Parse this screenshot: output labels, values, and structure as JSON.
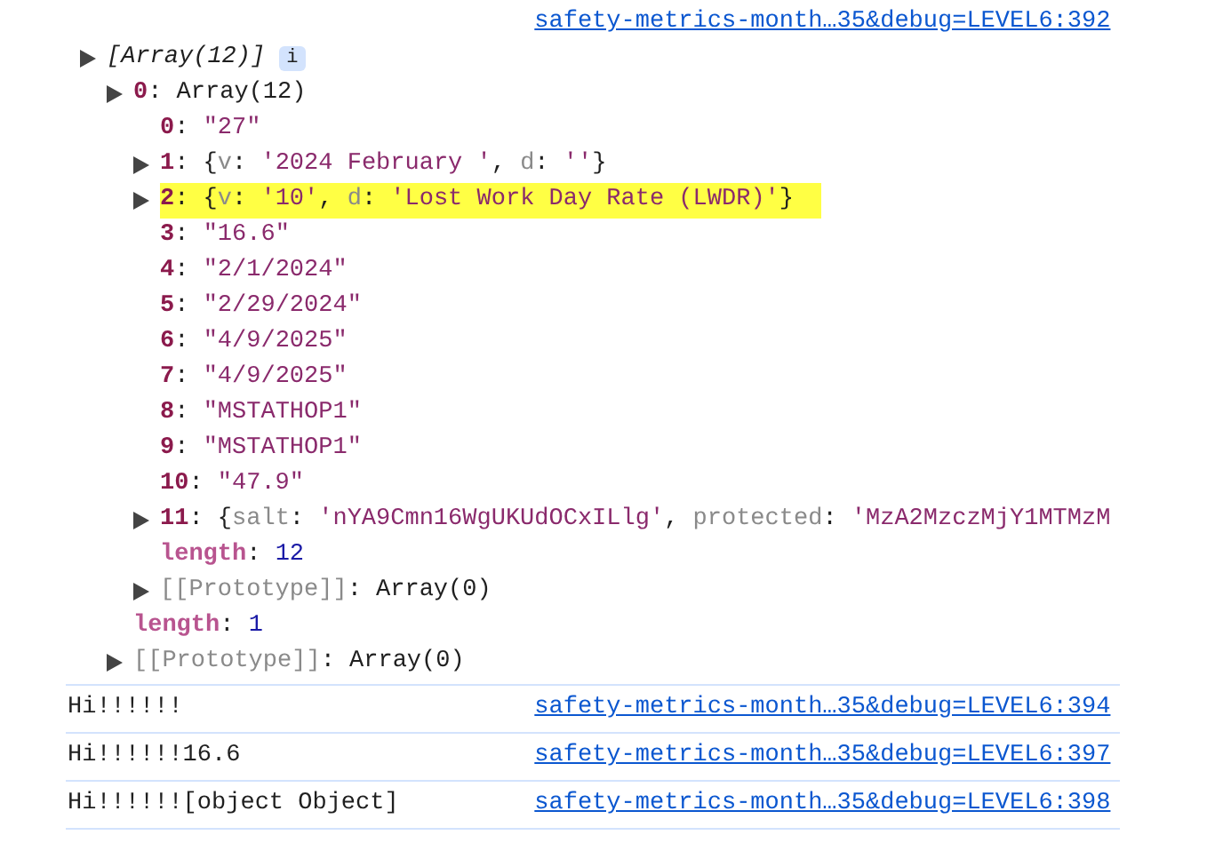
{
  "console": {
    "entries": [
      {
        "kind": "object",
        "link": "safety-metrics-month…35&debug=LEVEL6:392",
        "tree": [
          {
            "kind": "expandable",
            "badge": "i",
            "highlighted": false,
            "segments": [
              {
                "kind": "italic",
                "text": "[Array(12)]"
              }
            ],
            "children": [
              {
                "kind": "expandable",
                "highlighted": false,
                "segments": [
                  {
                    "kind": "index",
                    "text": "0"
                  },
                  {
                    "kind": "punct",
                    "text": ": Array(12)"
                  }
                ],
                "children": [
                  {
                    "kind": "leaf",
                    "highlighted": false,
                    "segments": [
                      {
                        "kind": "index",
                        "text": "0"
                      },
                      {
                        "kind": "punct",
                        "text": ": "
                      },
                      {
                        "kind": "string",
                        "text": "\"27\""
                      }
                    ]
                  },
                  {
                    "kind": "expandable",
                    "highlighted": false,
                    "segments": [
                      {
                        "kind": "index",
                        "text": "1"
                      },
                      {
                        "kind": "punct",
                        "text": ": {"
                      },
                      {
                        "kind": "preview_key",
                        "text": "v"
                      },
                      {
                        "kind": "punct",
                        "text": ": "
                      },
                      {
                        "kind": "string",
                        "text": "'2024 February '"
                      },
                      {
                        "kind": "punct",
                        "text": ", "
                      },
                      {
                        "kind": "preview_key",
                        "text": "d"
                      },
                      {
                        "kind": "punct",
                        "text": ": "
                      },
                      {
                        "kind": "string",
                        "text": "''"
                      },
                      {
                        "kind": "punct",
                        "text": "}"
                      }
                    ]
                  },
                  {
                    "kind": "expandable",
                    "highlighted": true,
                    "segments": [
                      {
                        "kind": "index",
                        "text": "2"
                      },
                      {
                        "kind": "punct",
                        "text": ": {"
                      },
                      {
                        "kind": "preview_key",
                        "text": "v"
                      },
                      {
                        "kind": "punct",
                        "text": ": "
                      },
                      {
                        "kind": "string",
                        "text": "'10'"
                      },
                      {
                        "kind": "punct",
                        "text": ", "
                      },
                      {
                        "kind": "preview_key",
                        "text": "d"
                      },
                      {
                        "kind": "punct",
                        "text": ": "
                      },
                      {
                        "kind": "string",
                        "text": "'Lost Work Day Rate (LWDR)'"
                      },
                      {
                        "kind": "punct",
                        "text": "}"
                      }
                    ]
                  },
                  {
                    "kind": "leaf",
                    "highlighted": false,
                    "segments": [
                      {
                        "kind": "index",
                        "text": "3"
                      },
                      {
                        "kind": "punct",
                        "text": ": "
                      },
                      {
                        "kind": "string",
                        "text": "\"16.6\""
                      }
                    ]
                  },
                  {
                    "kind": "leaf",
                    "highlighted": false,
                    "segments": [
                      {
                        "kind": "index",
                        "text": "4"
                      },
                      {
                        "kind": "punct",
                        "text": ": "
                      },
                      {
                        "kind": "string",
                        "text": "\"2/1/2024\""
                      }
                    ]
                  },
                  {
                    "kind": "leaf",
                    "highlighted": false,
                    "segments": [
                      {
                        "kind": "index",
                        "text": "5"
                      },
                      {
                        "kind": "punct",
                        "text": ": "
                      },
                      {
                        "kind": "string",
                        "text": "\"2/29/2024\""
                      }
                    ]
                  },
                  {
                    "kind": "leaf",
                    "highlighted": false,
                    "segments": [
                      {
                        "kind": "index",
                        "text": "6"
                      },
                      {
                        "kind": "punct",
                        "text": ": "
                      },
                      {
                        "kind": "string",
                        "text": "\"4/9/2025\""
                      }
                    ]
                  },
                  {
                    "kind": "leaf",
                    "highlighted": false,
                    "segments": [
                      {
                        "kind": "index",
                        "text": "7"
                      },
                      {
                        "kind": "punct",
                        "text": ": "
                      },
                      {
                        "kind": "string",
                        "text": "\"4/9/2025\""
                      }
                    ]
                  },
                  {
                    "kind": "leaf",
                    "highlighted": false,
                    "segments": [
                      {
                        "kind": "index",
                        "text": "8"
                      },
                      {
                        "kind": "punct",
                        "text": ": "
                      },
                      {
                        "kind": "string",
                        "text": "\"MSTATHOP1\""
                      }
                    ]
                  },
                  {
                    "kind": "leaf",
                    "highlighted": false,
                    "segments": [
                      {
                        "kind": "index",
                        "text": "9"
                      },
                      {
                        "kind": "punct",
                        "text": ": "
                      },
                      {
                        "kind": "string",
                        "text": "\"MSTATHOP1\""
                      }
                    ]
                  },
                  {
                    "kind": "leaf",
                    "highlighted": false,
                    "segments": [
                      {
                        "kind": "index",
                        "text": "10"
                      },
                      {
                        "kind": "punct",
                        "text": ": "
                      },
                      {
                        "kind": "string",
                        "text": "\"47.9\""
                      }
                    ]
                  },
                  {
                    "kind": "expandable",
                    "highlighted": false,
                    "segments": [
                      {
                        "kind": "index",
                        "text": "11"
                      },
                      {
                        "kind": "punct",
                        "text": ": {"
                      },
                      {
                        "kind": "preview_key",
                        "text": "salt"
                      },
                      {
                        "kind": "punct",
                        "text": ": "
                      },
                      {
                        "kind": "string",
                        "text": "'nYA9Cmn16WgUKUdOCxILlg'"
                      },
                      {
                        "kind": "punct",
                        "text": ", "
                      },
                      {
                        "kind": "preview_key",
                        "text": "protected"
                      },
                      {
                        "kind": "punct",
                        "text": ": "
                      },
                      {
                        "kind": "string",
                        "text": "'MzA2MzczMjY1MTMzM"
                      }
                    ]
                  },
                  {
                    "kind": "leaf",
                    "highlighted": false,
                    "segments": [
                      {
                        "kind": "meta",
                        "text": "length"
                      },
                      {
                        "kind": "punct",
                        "text": ": "
                      },
                      {
                        "kind": "number",
                        "text": "12"
                      }
                    ]
                  },
                  {
                    "kind": "expandable",
                    "highlighted": false,
                    "segments": [
                      {
                        "kind": "internal",
                        "text": "[[Prototype]]"
                      },
                      {
                        "kind": "punct",
                        "text": ": Array(0)"
                      }
                    ]
                  }
                ]
              },
              {
                "kind": "leaf",
                "highlighted": false,
                "segments": [
                  {
                    "kind": "meta",
                    "text": "length"
                  },
                  {
                    "kind": "punct",
                    "text": ": "
                  },
                  {
                    "kind": "number",
                    "text": "1"
                  }
                ]
              },
              {
                "kind": "expandable",
                "highlighted": false,
                "segments": [
                  {
                    "kind": "internal",
                    "text": "[[Prototype]]"
                  },
                  {
                    "kind": "punct",
                    "text": ": Array(0)"
                  }
                ]
              }
            ]
          }
        ]
      },
      {
        "kind": "text",
        "text": "Hi!!!!!!",
        "link": "safety-metrics-month…35&debug=LEVEL6:394"
      },
      {
        "kind": "text",
        "text": "Hi!!!!!!16.6",
        "link": "safety-metrics-month…35&debug=LEVEL6:397"
      },
      {
        "kind": "text",
        "text": "Hi!!!!!![object Object]",
        "link": "safety-metrics-month…35&debug=LEVEL6:398"
      }
    ]
  }
}
